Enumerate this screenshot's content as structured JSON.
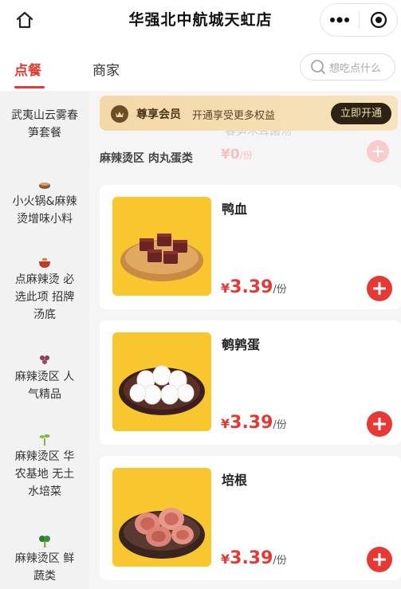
{
  "header": {
    "title": "华强北中航城天虹店",
    "icons": [
      "home-icon",
      "more-dots-icon",
      "target-icon"
    ]
  },
  "tabs": [
    {
      "label": "点餐",
      "active": true
    },
    {
      "label": "商家",
      "active": false
    }
  ],
  "search": {
    "placeholder": "想吃点什么"
  },
  "sidebar": {
    "items": [
      {
        "label": "武夷山云雾春笋套餐",
        "lines": [
          "武夷山云雾春",
          "笋套餐"
        ]
      },
      {
        "label": "小火锅&麻辣烫增味小料",
        "lines": [
          "小火锅&麻辣",
          "烫增味小料"
        ]
      },
      {
        "label": "点麻辣烫 必选此项 招牌汤底",
        "lines": [
          "点麻辣烫 必",
          "选此项 招牌",
          "汤底"
        ]
      },
      {
        "label": "麻辣烫区 人气精品",
        "lines": [
          "麻辣烫区 人",
          "气精品"
        ]
      },
      {
        "label": "麻辣烫区 华农基地 无土水培菜",
        "lines": [
          "麻辣烫区 华",
          "农基地 无土",
          "水培菜"
        ]
      },
      {
        "label": "麻辣烫区 鲜蔬类",
        "lines": [
          "麻辣烫区 鲜",
          "蔬类"
        ]
      }
    ]
  },
  "vip_banner": {
    "title": "尊享会员",
    "desc": "开通享受更多权益",
    "button": "立即开通"
  },
  "faded_item": {
    "name": "春笋木耳菌汤",
    "price": "¥0",
    "unit": "/份"
  },
  "category": "麻辣烫区 肉丸蛋类",
  "products": [
    {
      "name": "鸭血",
      "price": "3.39",
      "currency": "¥",
      "unit": "/份"
    },
    {
      "name": "鹌鹑蛋",
      "price": "3.39",
      "currency": "¥",
      "unit": "/份"
    },
    {
      "name": "培根",
      "price": "3.39",
      "currency": "¥",
      "unit": "/份"
    }
  ],
  "colors": {
    "accent": "#e53935",
    "product_bg": "#f8c62f",
    "vip_bg": "#f3d8a8"
  }
}
